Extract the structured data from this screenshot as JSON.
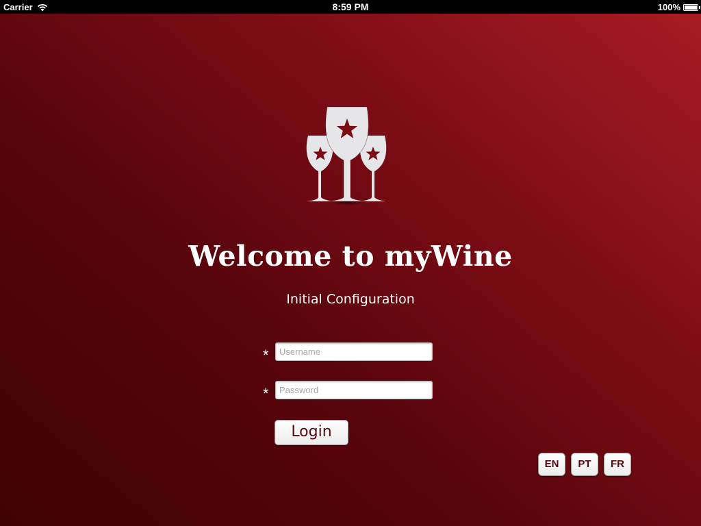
{
  "status_bar": {
    "carrier": "Carrier",
    "time": "8:59 PM",
    "battery": "100%",
    "battery_level": 1.0
  },
  "colors": {
    "background_light": "#a81b24",
    "background_dark": "#3e0204",
    "accent_text": "#5a070d",
    "logo_glass": "#e6e6e8"
  },
  "logo": {
    "icon": "wine-glasses-stars-icon"
  },
  "title": "Welcome to myWine",
  "subtitle": "Initial Configuration",
  "form": {
    "required_marker": "*",
    "username": {
      "placeholder": "Username",
      "value": ""
    },
    "password": {
      "placeholder": "Password",
      "value": ""
    },
    "login_label": "Login"
  },
  "languages": [
    "EN",
    "PT",
    "FR"
  ]
}
